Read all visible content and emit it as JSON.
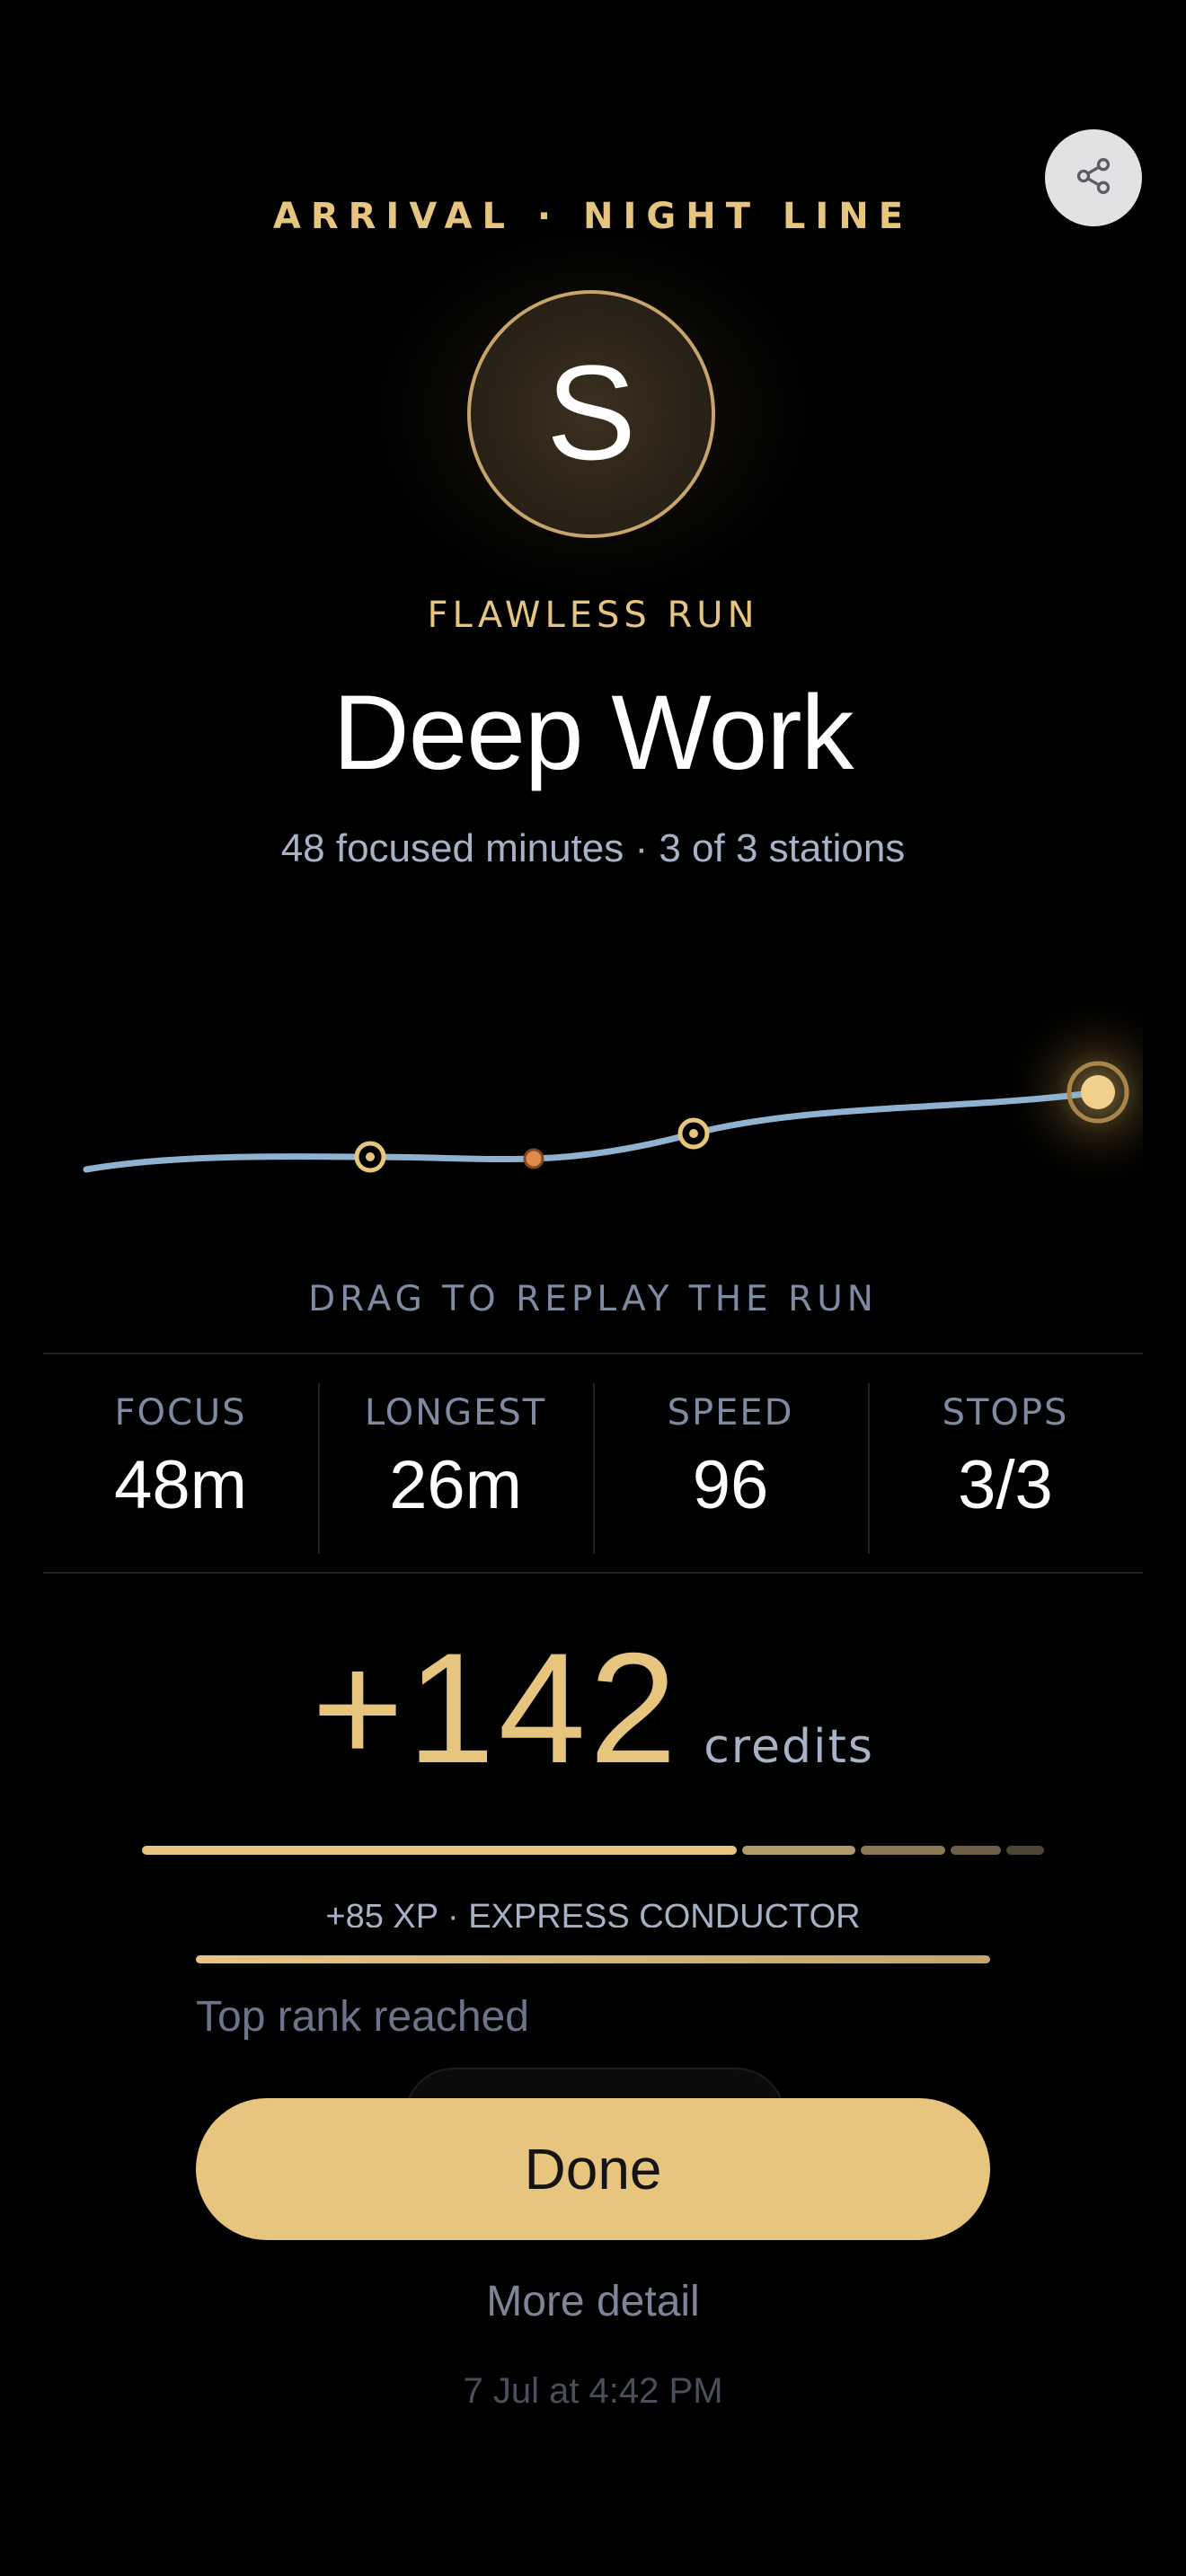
{
  "header": {
    "eyebrow": "ARRIVAL · NIGHT LINE",
    "share_icon": "share-icon"
  },
  "medallion": {
    "letter": "S"
  },
  "badge": "FLAWLESS RUN",
  "title": "Deep Work",
  "subtitle": "48 focused minutes · 3 of 3 stations",
  "track": {
    "hint": "DRAG TO REPLAY THE RUN",
    "stations_reached": 3,
    "stations_total": 3,
    "colors": {
      "route": "#8fb2d0",
      "station": "#e8c57e",
      "stop": "#e08a4a",
      "destination": "#e8c57e"
    }
  },
  "stats": [
    {
      "label": "FOCUS",
      "value": "48m"
    },
    {
      "label": "LONGEST",
      "value": "26m"
    },
    {
      "label": "SPEED",
      "value": "96"
    },
    {
      "label": "STOPS",
      "value": "3/3"
    }
  ],
  "reward": {
    "amount": "+142",
    "unit": "credits",
    "xp_line": "+85 XP · EXPRESS CONDUCTOR",
    "rank_text": "Top rank reached",
    "rank_progress": 1.0
  },
  "actions": {
    "done_label": "Done",
    "more_detail_label": "More detail"
  },
  "timestamp": "7 Jul at 4:42 PM",
  "colors": {
    "accent": "#e8c57e",
    "muted_text": "#a8b2c6",
    "background": "#000000"
  }
}
